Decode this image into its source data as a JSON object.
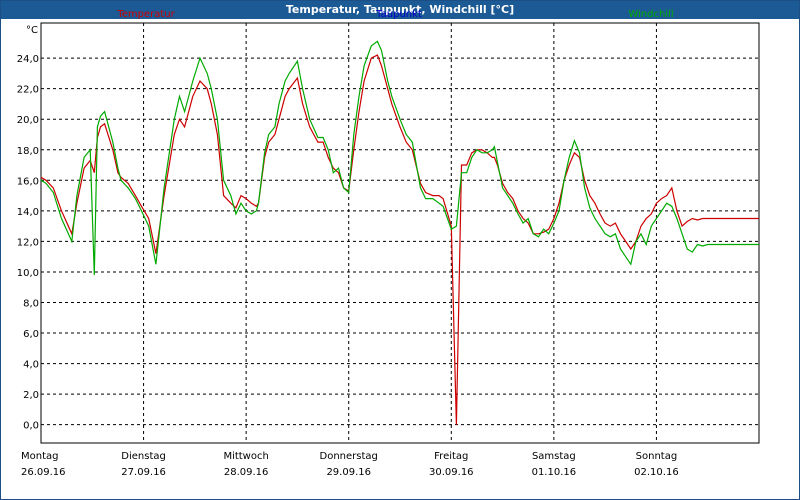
{
  "window": {
    "title": "Temperatur, Taupunkt, Windchill [°C]"
  },
  "colors": {
    "temperature": "#cc0000",
    "dewpoint": "#0000cc",
    "windchill": "#00aa00",
    "grid": "#000000",
    "titlebar": "#1c5a96"
  },
  "chart_data": {
    "type": "line",
    "title": "Temperatur, Taupunkt, Windchill [°C]",
    "ylabel": "°C",
    "ylim": [
      -1.2,
      26.3
    ],
    "yticks": [
      "0,0",
      "2,0",
      "4,0",
      "6,0",
      "8,0",
      "10,0",
      "12,0",
      "14,0",
      "16,0",
      "18,0",
      "20,0",
      "22,0",
      "24,0"
    ],
    "ytick_values": [
      0,
      2,
      4,
      6,
      8,
      10,
      12,
      14,
      16,
      18,
      20,
      22,
      24
    ],
    "days": [
      {
        "day": "Montag",
        "date": "26.09.16"
      },
      {
        "day": "Dienstag",
        "date": "27.09.16"
      },
      {
        "day": "Mittwoch",
        "date": "28.09.16"
      },
      {
        "day": "Donnerstag",
        "date": "29.09.16"
      },
      {
        "day": "Freitag",
        "date": "30.09.16"
      },
      {
        "day": "Samstag",
        "date": "01.10.16"
      },
      {
        "day": "Sonntag",
        "date": "02.10.16"
      }
    ],
    "xlim": [
      0,
      7
    ],
    "grid": true,
    "legend_placement": "top",
    "series": [
      {
        "name": "Temperatur",
        "color": "#cc0000",
        "x": [
          0,
          0.05,
          0.12,
          0.2,
          0.3,
          0.35,
          0.42,
          0.48,
          0.52,
          0.55,
          0.58,
          0.62,
          0.7,
          0.75,
          0.78,
          0.85,
          0.92,
          0.98,
          1.05,
          1.12,
          1.2,
          1.3,
          1.35,
          1.4,
          1.48,
          1.55,
          1.62,
          1.66,
          1.72,
          1.78,
          1.85,
          1.9,
          1.95,
          2.0,
          2.05,
          2.1,
          2.12,
          2.18,
          2.22,
          2.28,
          2.32,
          2.38,
          2.42,
          2.5,
          2.55,
          2.62,
          2.7,
          2.75,
          2.8,
          2.85,
          2.9,
          2.95,
          3.0,
          3.05,
          3.1,
          3.15,
          3.22,
          3.28,
          3.32,
          3.38,
          3.42,
          3.5,
          3.56,
          3.62,
          3.7,
          3.75,
          3.82,
          3.88,
          3.92,
          4.0,
          4.05,
          4.1,
          4.15,
          4.2,
          4.25,
          4.3,
          4.35,
          4.4,
          4.42,
          4.45,
          4.5,
          4.55,
          4.6,
          4.65,
          4.7,
          4.75,
          4.8,
          4.85,
          4.9,
          4.95,
          5.0,
          5.05,
          5.1,
          5.15,
          5.2,
          5.25,
          5.3,
          5.35,
          5.4,
          5.45,
          5.5,
          5.55,
          5.6,
          5.65,
          5.7,
          5.75,
          5.8,
          5.85,
          5.9,
          5.95,
          6.0,
          6.05,
          6.1,
          6.15,
          6.2,
          6.25,
          6.3,
          6.35,
          6.4,
          6.45,
          6.5,
          6.55,
          6.6,
          6.65,
          6.7,
          6.75,
          6.8,
          6.85,
          6.9,
          6.95,
          7.0
        ],
        "y": [
          16.2,
          16.0,
          15.5,
          14.0,
          12.5,
          14.5,
          16.8,
          17.3,
          16.5,
          18.8,
          19.5,
          19.7,
          18.0,
          16.5,
          16.2,
          15.8,
          15.0,
          14.3,
          13.5,
          11.2,
          15.0,
          19.0,
          20.0,
          19.5,
          21.5,
          22.5,
          22.0,
          21.0,
          19.0,
          15.0,
          14.5,
          14.2,
          15.0,
          14.8,
          14.5,
          14.3,
          14.5,
          17.5,
          18.5,
          19.0,
          20.0,
          21.5,
          22.0,
          22.7,
          21.0,
          19.5,
          18.5,
          18.5,
          17.5,
          16.8,
          16.5,
          15.5,
          15.3,
          18.0,
          20.5,
          22.5,
          24.0,
          24.2,
          23.5,
          22.0,
          21.0,
          19.5,
          18.5,
          18.0,
          15.8,
          15.2,
          15.0,
          15.0,
          14.8,
          13.0,
          0.0,
          17.0,
          17.0,
          17.8,
          18.0,
          18.0,
          17.8,
          17.5,
          17.5,
          17.0,
          15.8,
          15.2,
          14.8,
          14.0,
          13.5,
          13.2,
          12.5,
          12.5,
          12.6,
          12.8,
          13.5,
          14.5,
          16.0,
          17.0,
          17.8,
          17.5,
          16.0,
          15.0,
          14.5,
          13.8,
          13.2,
          13.0,
          13.2,
          12.5,
          12.0,
          11.5,
          12.0,
          13.0,
          13.5,
          13.8,
          14.5,
          14.8,
          15.0,
          15.5,
          14.0,
          13.0,
          13.3,
          13.5,
          13.4,
          13.5,
          13.5,
          13.5,
          13.5,
          13.5,
          13.5,
          13.5,
          13.5,
          13.5,
          13.5,
          13.5,
          13.5
        ]
      },
      {
        "name": "Taupunkt",
        "color": "#0000cc",
        "x": [],
        "y": []
      },
      {
        "name": "Windchill",
        "color": "#00aa00",
        "x": [
          0,
          0.05,
          0.12,
          0.2,
          0.3,
          0.35,
          0.42,
          0.48,
          0.52,
          0.55,
          0.58,
          0.62,
          0.7,
          0.75,
          0.78,
          0.85,
          0.92,
          0.98,
          1.05,
          1.12,
          1.2,
          1.3,
          1.35,
          1.4,
          1.48,
          1.55,
          1.62,
          1.66,
          1.72,
          1.78,
          1.85,
          1.9,
          1.95,
          2.0,
          2.05,
          2.1,
          2.12,
          2.18,
          2.22,
          2.28,
          2.32,
          2.38,
          2.42,
          2.5,
          2.55,
          2.62,
          2.7,
          2.75,
          2.8,
          2.85,
          2.9,
          2.95,
          3.0,
          3.05,
          3.1,
          3.15,
          3.22,
          3.28,
          3.32,
          3.38,
          3.42,
          3.5,
          3.56,
          3.62,
          3.7,
          3.75,
          3.82,
          3.88,
          3.92,
          4.0,
          4.05,
          4.1,
          4.15,
          4.2,
          4.25,
          4.3,
          4.35,
          4.4,
          4.42,
          4.45,
          4.5,
          4.55,
          4.6,
          4.65,
          4.7,
          4.75,
          4.8,
          4.85,
          4.9,
          4.95,
          5.0,
          5.05,
          5.1,
          5.15,
          5.2,
          5.25,
          5.3,
          5.35,
          5.4,
          5.45,
          5.5,
          5.55,
          5.6,
          5.65,
          5.7,
          5.75,
          5.8,
          5.85,
          5.9,
          5.95,
          6.0,
          6.05,
          6.1,
          6.15,
          6.2,
          6.25,
          6.3,
          6.35,
          6.4,
          6.45,
          6.5,
          6.55,
          6.6,
          6.65,
          6.7,
          6.75,
          6.8,
          6.85,
          6.9,
          6.95,
          7.0
        ],
        "y": [
          16.0,
          15.8,
          15.2,
          13.5,
          12.0,
          15.0,
          17.5,
          18.0,
          9.8,
          19.5,
          20.2,
          20.5,
          18.5,
          16.8,
          16.0,
          15.5,
          14.8,
          14.0,
          13.0,
          10.5,
          15.5,
          20.0,
          21.5,
          20.5,
          22.5,
          24.0,
          23.0,
          22.0,
          20.0,
          16.0,
          15.0,
          13.8,
          14.5,
          14.0,
          13.8,
          14.0,
          14.5,
          17.8,
          19.0,
          19.5,
          21.0,
          22.5,
          23.0,
          23.8,
          22.0,
          20.0,
          18.8,
          18.8,
          18.0,
          16.5,
          16.8,
          15.5,
          15.2,
          19.0,
          21.5,
          23.5,
          24.8,
          25.1,
          24.5,
          22.5,
          21.5,
          20.0,
          19.0,
          18.5,
          15.5,
          14.8,
          14.8,
          14.5,
          14.3,
          12.8,
          13.0,
          16.5,
          16.5,
          17.5,
          18.0,
          17.8,
          17.8,
          18.0,
          18.2,
          17.2,
          15.5,
          15.0,
          14.5,
          13.8,
          13.2,
          13.5,
          12.5,
          12.3,
          12.8,
          12.5,
          13.2,
          14.0,
          16.0,
          17.5,
          18.6,
          17.8,
          15.5,
          14.2,
          13.5,
          13.0,
          12.5,
          12.3,
          12.5,
          11.5,
          11.0,
          10.5,
          12.0,
          12.5,
          11.8,
          13.0,
          13.5,
          14.0,
          14.5,
          14.3,
          13.5,
          12.5,
          11.5,
          11.3,
          11.8,
          11.7,
          11.8,
          11.8,
          11.8,
          11.8,
          11.8,
          11.8,
          11.8,
          11.8,
          11.8,
          11.8,
          11.8
        ]
      }
    ]
  }
}
